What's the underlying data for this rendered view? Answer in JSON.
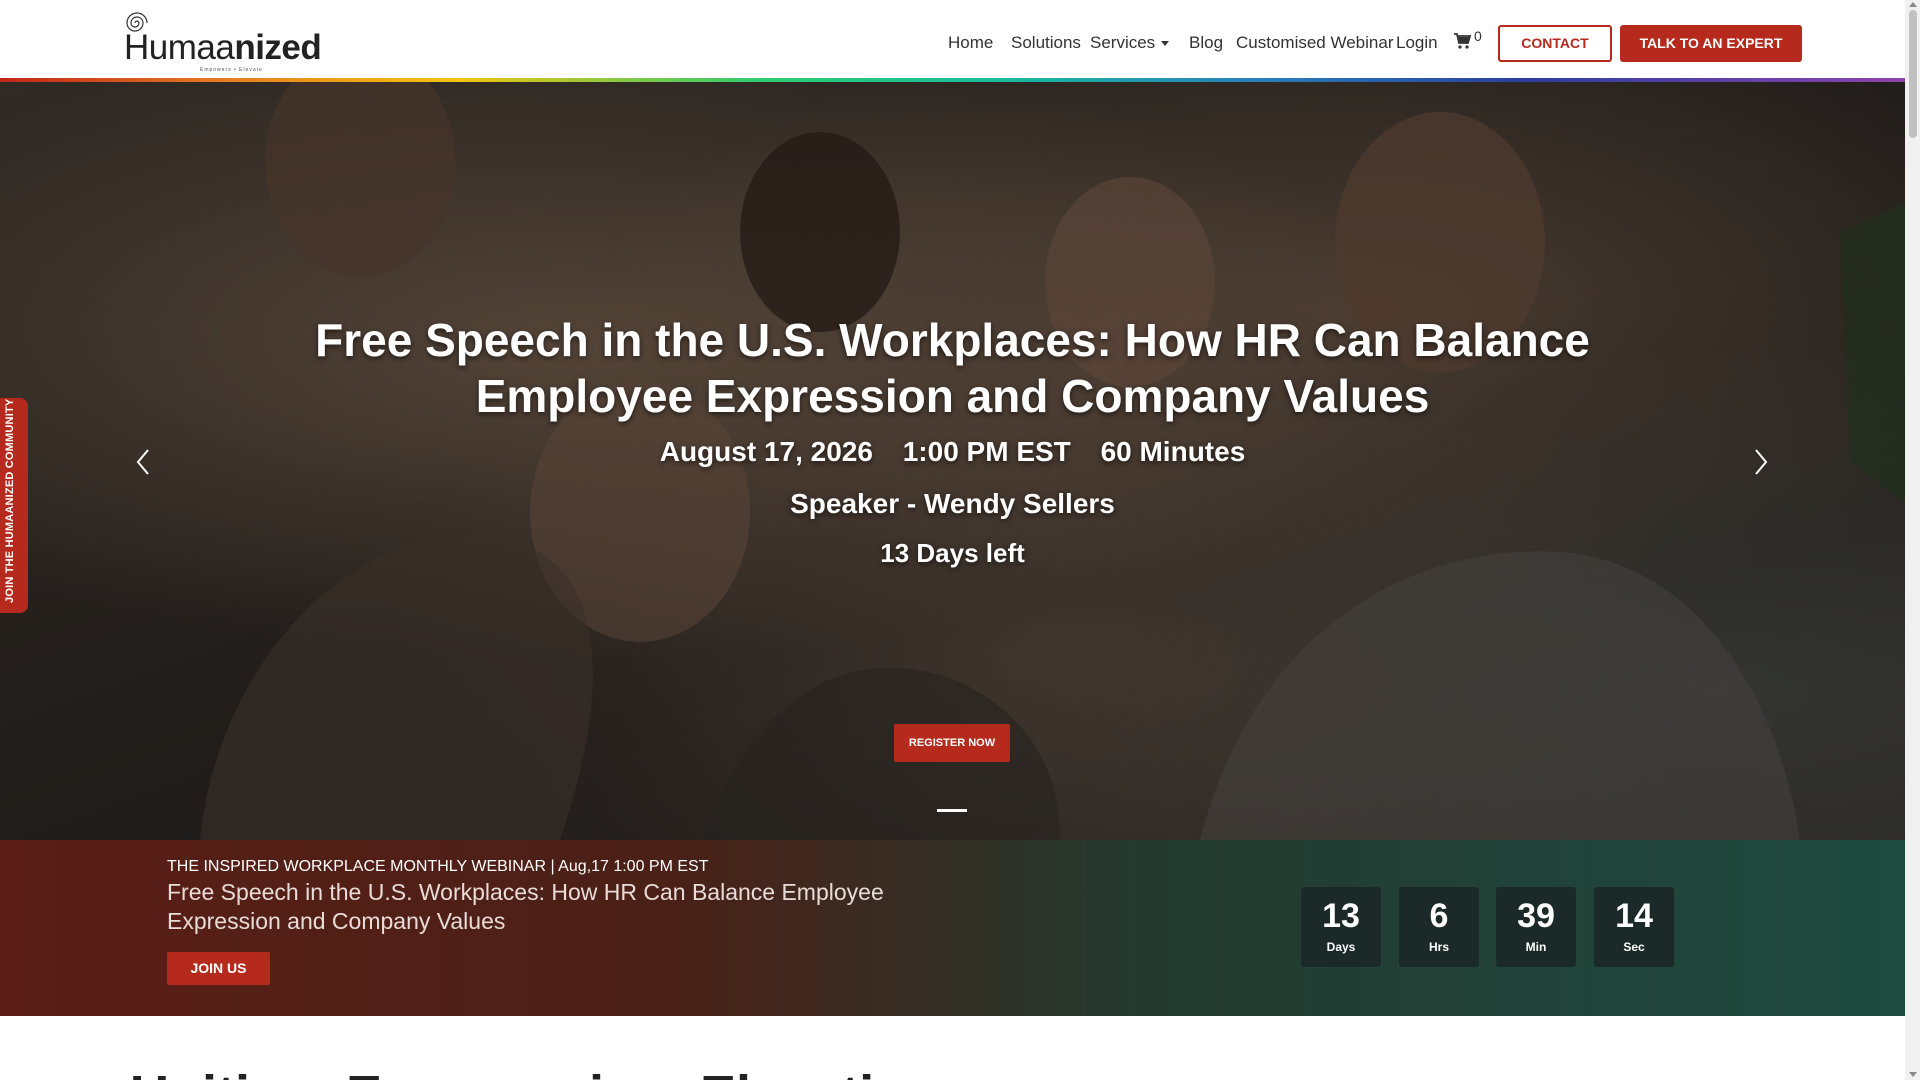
{
  "brand": {
    "name_light": "Humaa",
    "name_bold": "nized",
    "tagline": "Empowers • Elevate"
  },
  "nav": {
    "items": [
      "Home",
      "Solutions",
      "Services",
      "Blog",
      "Customised Webinar",
      "Login"
    ],
    "cart_count": "0",
    "contact_label": "CONTACT",
    "expert_label": "TALK TO AN EXPERT"
  },
  "side_tab": {
    "label": "JOIN THE HUMAANIZED COMMUNITY"
  },
  "hero": {
    "title": "Free Speech in the U.S. Workplaces: How HR Can Balance Employee Expression and Company Values",
    "date": "August 17, 2026",
    "time": "1:00 PM EST",
    "duration": "60 Minutes",
    "speaker": "Speaker - Wendy Sellers",
    "days_left": "13 Days left",
    "register_label": "REGISTER NOW",
    "slide_index": 1
  },
  "banner": {
    "kicker": "THE INSPIRED WORKPLACE MONTHLY WEBINAR | Aug,17 1:00 PM EST",
    "title": "Free Speech in the U.S. Workplaces: How HR Can Balance Employee Expression and Company Values",
    "join_label": "JOIN US",
    "countdown": [
      {
        "value": "13",
        "label": "Days"
      },
      {
        "value": "6",
        "label": "Hrs"
      },
      {
        "value": "39",
        "label": "Min"
      },
      {
        "value": "14",
        "label": "Sec"
      }
    ]
  },
  "next_section": {
    "heading": "Uniting, Empowering, Elevating"
  },
  "colors": {
    "accent": "#b52a1c",
    "countdown_box": "#1b2a28"
  }
}
